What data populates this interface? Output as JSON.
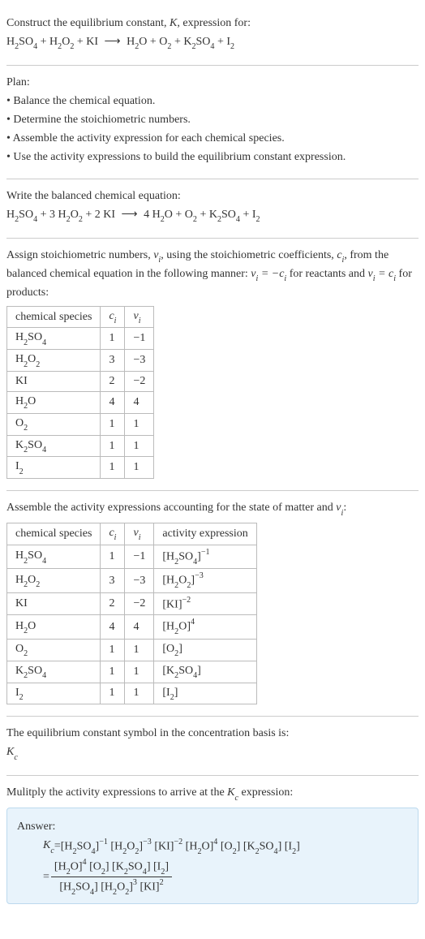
{
  "intro": {
    "line1_a": "Construct the equilibrium constant, ",
    "line1_k": "K",
    "line1_b": ", expression for:",
    "eq_lhs_parts": [
      "H",
      "2",
      "SO",
      "4",
      " + H",
      "2",
      "O",
      "2",
      " + KI "
    ],
    "arrow": "⟶",
    "eq_rhs_parts": [
      " H",
      "2",
      "O + O",
      "2",
      " + K",
      "2",
      "SO",
      "4",
      " + I",
      "2"
    ]
  },
  "plan": {
    "title": "Plan:",
    "b1": "• Balance the chemical equation.",
    "b2": "• Determine the stoichiometric numbers.",
    "b3": "• Assemble the activity expression for each chemical species.",
    "b4": "• Use the activity expressions to build the equilibrium constant expression."
  },
  "balanced": {
    "title": "Write the balanced chemical equation:",
    "lhs": "H₂SO₄ + 3 H₂O₂ + 2 KI ",
    "arrow": "⟶",
    "rhs": " 4 H₂O + O₂ + K₂SO₄ + I₂"
  },
  "stoich": {
    "text_a": "Assign stoichiometric numbers, ",
    "nu_i": "νᵢ",
    "text_b": ", using the stoichiometric coefficients, ",
    "c_i": "cᵢ",
    "text_c": ", from the balanced chemical equation in the following manner: ",
    "rel1": "νᵢ = −cᵢ",
    "text_d": " for reactants and ",
    "rel2": "νᵢ = cᵢ",
    "text_e": " for products:",
    "headers": [
      "chemical species",
      "cᵢ",
      "νᵢ"
    ],
    "rows": [
      {
        "sp": "H₂SO₄",
        "c": "1",
        "v": "−1"
      },
      {
        "sp": "H₂O₂",
        "c": "3",
        "v": "−3"
      },
      {
        "sp": "KI",
        "c": "2",
        "v": "−2"
      },
      {
        "sp": "H₂O",
        "c": "4",
        "v": "4"
      },
      {
        "sp": "O₂",
        "c": "1",
        "v": "1"
      },
      {
        "sp": "K₂SO₄",
        "c": "1",
        "v": "1"
      },
      {
        "sp": "I₂",
        "c": "1",
        "v": "1"
      }
    ]
  },
  "activity": {
    "title_a": "Assemble the activity expressions accounting for the state of matter and ",
    "nu_i": "νᵢ",
    "title_b": ":",
    "headers": [
      "chemical species",
      "cᵢ",
      "νᵢ",
      "activity expression"
    ],
    "rows": [
      {
        "sp": "H₂SO₄",
        "c": "1",
        "v": "−1",
        "ae_base": "[H₂SO₄]",
        "ae_exp": "−1"
      },
      {
        "sp": "H₂O₂",
        "c": "3",
        "v": "−3",
        "ae_base": "[H₂O₂]",
        "ae_exp": "−3"
      },
      {
        "sp": "KI",
        "c": "2",
        "v": "−2",
        "ae_base": "[KI]",
        "ae_exp": "−2"
      },
      {
        "sp": "H₂O",
        "c": "4",
        "v": "4",
        "ae_base": "[H₂O]",
        "ae_exp": "4"
      },
      {
        "sp": "O₂",
        "c": "1",
        "v": "1",
        "ae_base": "[O₂]",
        "ae_exp": ""
      },
      {
        "sp": "K₂SO₄",
        "c": "1",
        "v": "1",
        "ae_base": "[K₂SO₄]",
        "ae_exp": ""
      },
      {
        "sp": "I₂",
        "c": "1",
        "v": "1",
        "ae_base": "[I₂]",
        "ae_exp": ""
      }
    ]
  },
  "kc_symbol": {
    "line1": "The equilibrium constant symbol in the concentration basis is:",
    "kc": "K",
    "kc_sub": "c"
  },
  "final": {
    "title": "Mulitply the activity expressions to arrive at the ",
    "kc": "K",
    "kc_sub": "c",
    "title_b": " expression:",
    "answer_label": "Answer:",
    "kc_eq_lhs": "K",
    "kc_eq_lhs_sub": "c",
    "eq": " = ",
    "prod_terms": [
      {
        "base": "[H₂SO₄]",
        "exp": "−1"
      },
      {
        "base": "[H₂O₂]",
        "exp": "−3"
      },
      {
        "base": "[KI]",
        "exp": "−2"
      },
      {
        "base": "[H₂O]",
        "exp": "4"
      },
      {
        "base": "[O₂]",
        "exp": ""
      },
      {
        "base": "[K₂SO₄]",
        "exp": ""
      },
      {
        "base": "[I₂]",
        "exp": ""
      }
    ],
    "frac_eq": " = ",
    "num_terms": [
      {
        "base": "[H₂O]",
        "exp": "4"
      },
      {
        "base": "[O₂]",
        "exp": ""
      },
      {
        "base": "[K₂SO₄]",
        "exp": ""
      },
      {
        "base": "[I₂]",
        "exp": ""
      }
    ],
    "den_terms": [
      {
        "base": "[H₂SO₄]",
        "exp": ""
      },
      {
        "base": "[H₂O₂]",
        "exp": "3"
      },
      {
        "base": "[KI]",
        "exp": "2"
      }
    ]
  }
}
